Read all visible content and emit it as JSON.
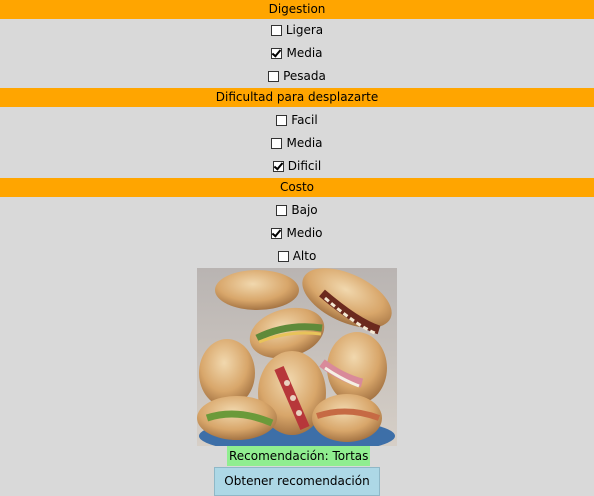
{
  "sections": [
    {
      "title": "Digestion",
      "options": [
        {
          "label": "Ligera",
          "checked": false
        },
        {
          "label": "Media",
          "checked": true
        },
        {
          "label": "Pesada",
          "checked": false
        }
      ]
    },
    {
      "title": "Dificultad para desplazarte",
      "options": [
        {
          "label": "Facil",
          "checked": false
        },
        {
          "label": "Media",
          "checked": false
        },
        {
          "label": "Dificil",
          "checked": true
        }
      ]
    },
    {
      "title": "Costo",
      "options": [
        {
          "label": "Bajo",
          "checked": false
        },
        {
          "label": "Medio",
          "checked": true
        },
        {
          "label": "Alto",
          "checked": false
        }
      ]
    }
  ],
  "image": {
    "subject": "tortas sandwiches photo"
  },
  "recommendation": "Recomendación: Tortas",
  "button": {
    "label": "Obtener recomendación"
  },
  "colors": {
    "header": "#ffa500",
    "background": "#d9d9d9",
    "recommendation": "#90ee90",
    "button": "#add8e6"
  }
}
